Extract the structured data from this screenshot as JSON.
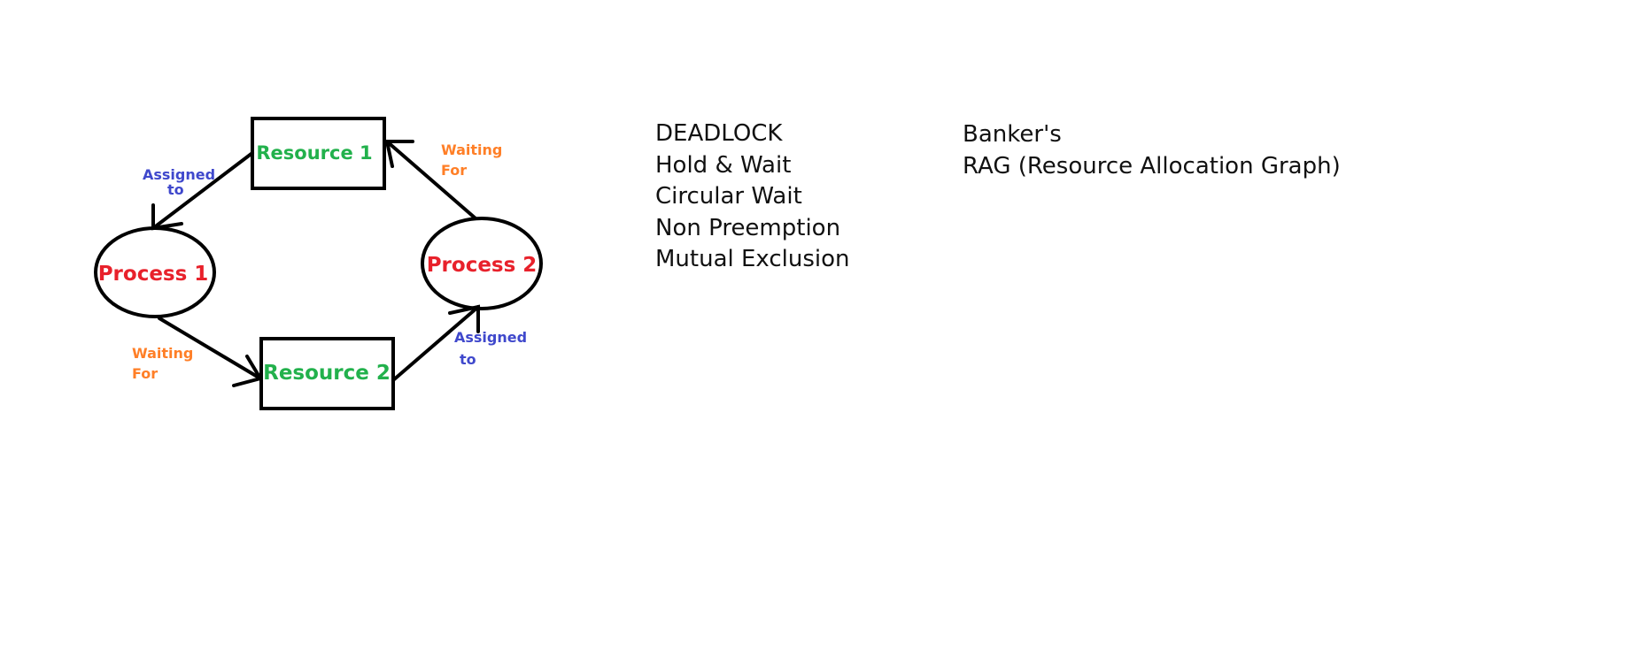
{
  "colors": {
    "process_text": "#e8212b",
    "resource_text": "#22b14c",
    "assigned_text": "#3f48cc",
    "waiting_text": "#ff7f27",
    "stroke": "#000000"
  },
  "diagram": {
    "nodes": {
      "resource1": "Resource 1",
      "resource2": "Resource 2",
      "process1": "Process 1",
      "process2": "Process 2"
    },
    "edge_labels": {
      "assigned_1": [
        "Assigned",
        "to"
      ],
      "waiting_1": [
        "Waiting",
        "For"
      ],
      "waiting_2": [
        "Waiting",
        "For"
      ],
      "assigned_2": [
        "Assigned",
        "to"
      ]
    }
  },
  "notes": {
    "col1": [
      "DEADLOCK",
      "Hold & Wait",
      "Circular Wait",
      "Non Preemption",
      "Mutual Exclusion"
    ],
    "col2": [
      "Banker's",
      "RAG (Resource Allocation Graph)"
    ]
  }
}
